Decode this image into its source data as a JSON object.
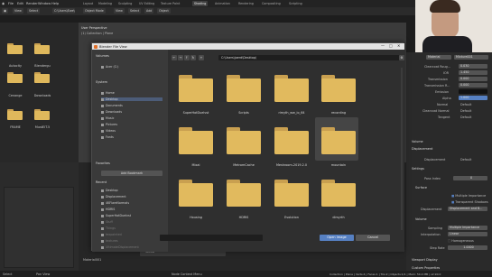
{
  "menu": [
    "File",
    "Edit",
    "Render",
    "Window",
    "Help"
  ],
  "workspace_tabs": [
    "Layout",
    "Modeling",
    "Sculpting",
    "UV Editing",
    "Texture Paint",
    "Shading",
    "Animation",
    "Rendering",
    "Compositing",
    "Scripting"
  ],
  "active_tab": "Shading",
  "viewport": {
    "mode": "Object Mode",
    "view": "View",
    "select": "Select",
    "add": "Add",
    "object": "Object",
    "perspective": "User Perspective",
    "collection": "(1) Collection | Plane"
  },
  "left_browser": {
    "header": [
      "View",
      "Select"
    ],
    "path": "C:\\Users\\Ewe\\Desktop",
    "folders": [
      "Autocity",
      "Blendergu",
      "Cenange",
      "Downloads",
      "FRAME",
      "MustEIT.5"
    ]
  },
  "dialog": {
    "title": "Blender File View",
    "volumes_header": "Volumes",
    "volumes": [
      "Acer (C:)"
    ],
    "system_header": "System",
    "system_items": [
      "Home",
      "Desktop",
      "Documents",
      "Downloads",
      "Music",
      "Pictures",
      "Videos",
      "Fonts"
    ],
    "favorites_header": "Favorites",
    "add_bookmark": "Add Bookmark",
    "recent_header": "Recent",
    "recent_items": [
      "Desktop",
      "Displacement",
      "4KFlareNormals",
      "HDRIS",
      "SuperHotDuelvst",
      "Stuff",
      "Things",
      "texpainted",
      "textures",
      "UltimateDisplacement"
    ],
    "path": "C:\\Users\\joerd\\Desktop\\",
    "folders": [
      {
        "name": "SuperHotDuelvst"
      },
      {
        "name": "Scripts"
      },
      {
        "name": "rimyth_ww_io_64"
      },
      {
        "name": "recording"
      },
      {
        "name": "Mixal"
      },
      {
        "name": "MetromCache"
      },
      {
        "name": "Meshroom-2019.2.0"
      },
      {
        "name": "mountain"
      },
      {
        "name": "Housing"
      },
      {
        "name": "HDRIS"
      },
      {
        "name": "Evolution"
      },
      {
        "name": "dimyrth"
      }
    ],
    "open_label": "Open Image",
    "cancel_label": "Cancel"
  },
  "right_panel": {
    "header": "Material",
    "mat_name": "Mixture001",
    "props": [
      {
        "label": "Clearcoat Roug...",
        "value": "0.030"
      },
      {
        "label": "IOR",
        "value": "1.450"
      },
      {
        "label": "Transmission",
        "value": "0.000"
      },
      {
        "label": "Transmission R...",
        "value": "0.000"
      },
      {
        "label": "Emission",
        "value": ""
      },
      {
        "label": "Alpha",
        "value": "1.000"
      },
      {
        "label": "Normal",
        "value": "Default"
      },
      {
        "label": "Clearcoat Normal",
        "value": "Default"
      },
      {
        "label": "Tangent",
        "value": "Default"
      }
    ],
    "volume": "Volume",
    "displacement": "Displacement",
    "disp_value": "Default",
    "settings": "Settings",
    "pass_index_label": "Pass Index",
    "pass_index": "0",
    "surface": "Surface",
    "multiple_importance": "Multiple Importance",
    "transparent_shadows": "Transparent Shadows",
    "displacement_label": "Displacement",
    "displacement_opt": "Displacement and B...",
    "volume2": "Volume",
    "sampling_label": "Sampling",
    "sampling_val": "Multiple Importance",
    "interp_label": "Interpolation",
    "interp_val": "Linear",
    "homogeneous": "Homogeneous",
    "step_rate_label": "Step Rate",
    "step_rate": "1.0000",
    "viewport_display": "Viewport Display",
    "custom_props": "Custom Properties"
  },
  "node_bar": {
    "label": "Vector"
  },
  "bottom_label": "Material001",
  "status": {
    "left": "Select",
    "mid": "Pan View",
    "right": "Node Context Menu",
    "info": "Collection | Plane | Verts:4 | Faces:1 | Tris:2 | Objects:1/1 | Mem: 50.4 MB | v2.90.0"
  }
}
